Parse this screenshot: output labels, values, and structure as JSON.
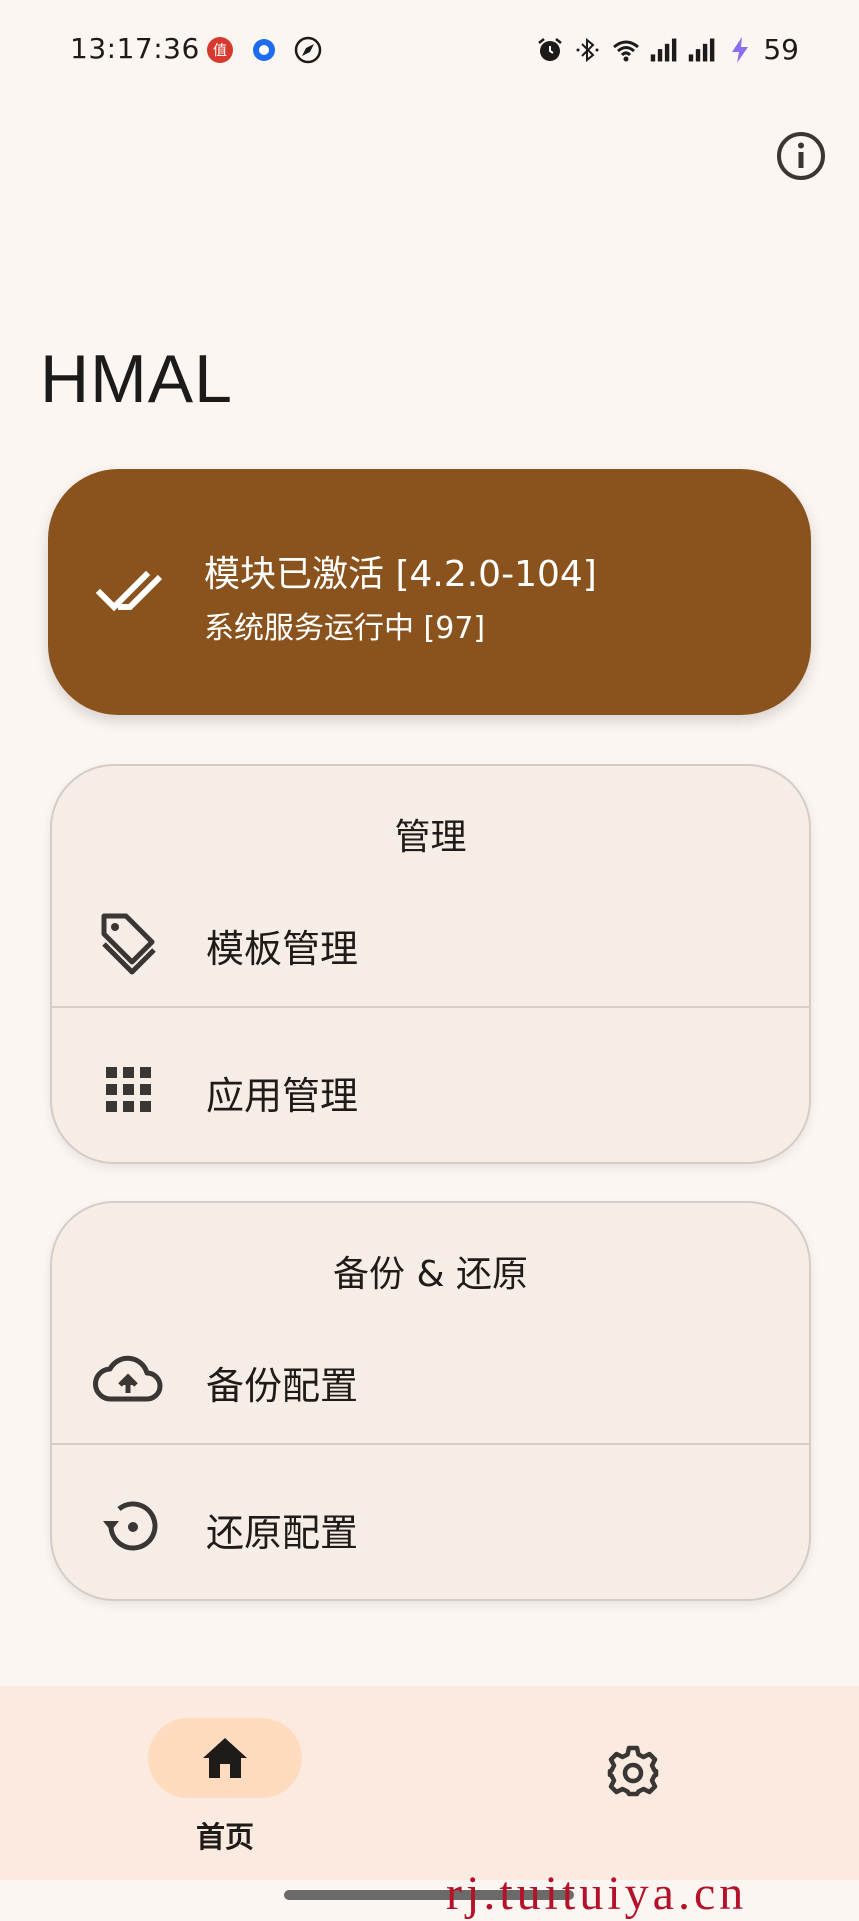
{
  "status_bar": {
    "time": "13:17:36",
    "battery": "59",
    "notification_icons": [
      "zhidemai-icon",
      "circle-app-icon",
      "compass-icon"
    ],
    "system_icons": [
      "alarm-icon",
      "bluetooth-icon",
      "wifi-icon",
      "signal-icon",
      "signal-icon",
      "charging-icon"
    ]
  },
  "page": {
    "title": "HMAL"
  },
  "status_card": {
    "line1": "模块已激活 [4.2.0-104]",
    "line2": "系统服务运行中 [97]",
    "icon": "double-check-icon",
    "color": "#8a531d"
  },
  "manage_section": {
    "title": "管理",
    "items": [
      {
        "label": "模板管理",
        "icon": "tags-icon"
      },
      {
        "label": "应用管理",
        "icon": "apps-grid-icon"
      }
    ]
  },
  "backup_section": {
    "title": "备份 & 还原",
    "items": [
      {
        "label": "备份配置",
        "icon": "cloud-upload-icon"
      },
      {
        "label": "还原配置",
        "icon": "restore-icon"
      }
    ]
  },
  "bottom_nav": {
    "home_label": "首页",
    "home_icon": "home-icon",
    "settings_icon": "gear-icon",
    "active_color": "#ffdcc0"
  },
  "watermark": "rj.tuituiya.cn"
}
